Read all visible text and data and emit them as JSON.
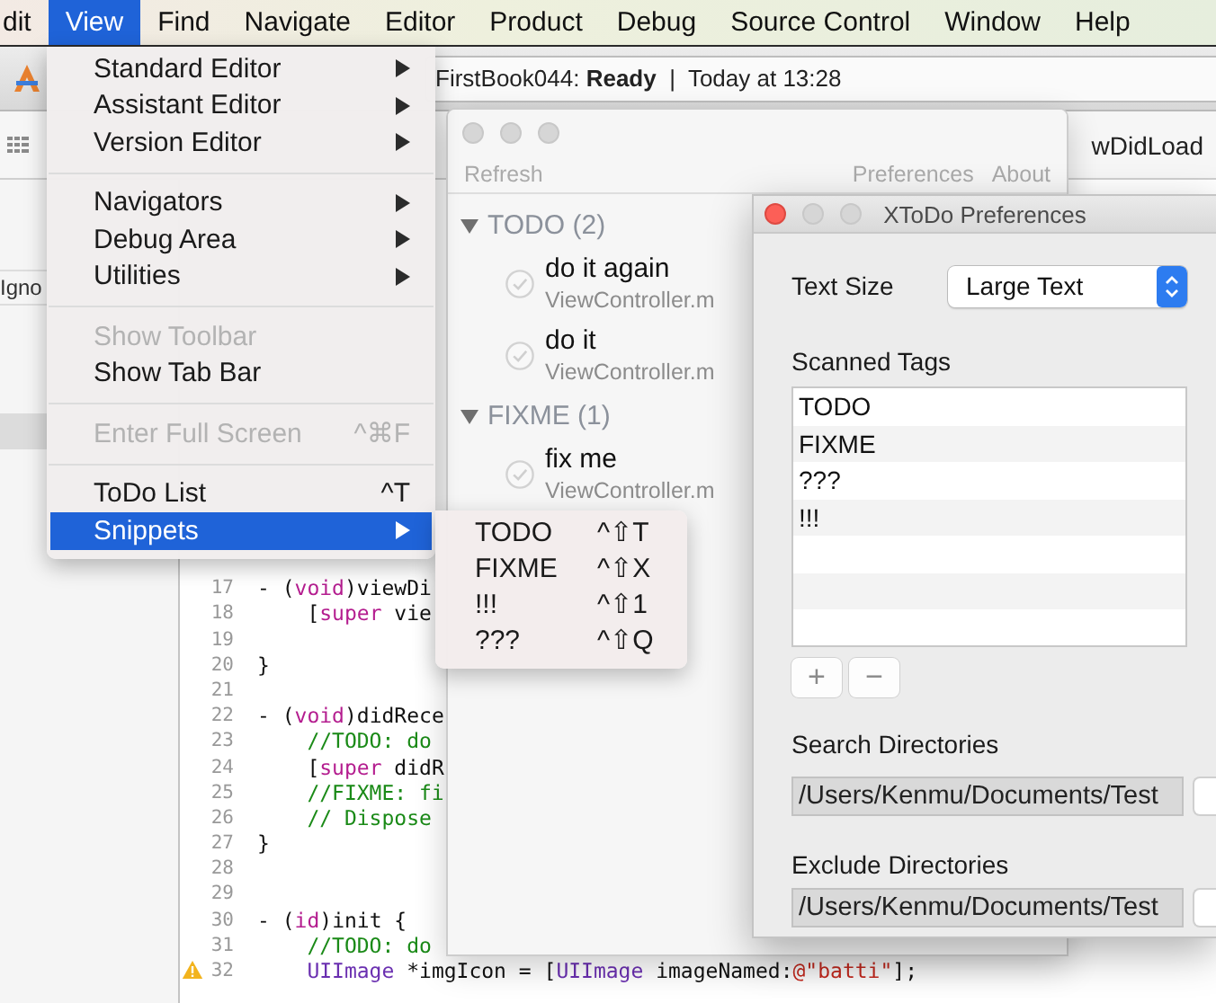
{
  "menu_bar": {
    "items": [
      {
        "label": "dit",
        "selected": false
      },
      {
        "label": "View",
        "selected": true
      },
      {
        "label": "Find",
        "selected": false
      },
      {
        "label": "Navigate",
        "selected": false
      },
      {
        "label": "Editor",
        "selected": false
      },
      {
        "label": "Product",
        "selected": false
      },
      {
        "label": "Debug",
        "selected": false
      },
      {
        "label": "Source Control",
        "selected": false
      },
      {
        "label": "Window",
        "selected": false
      },
      {
        "label": "Help",
        "selected": false
      }
    ]
  },
  "xcode": {
    "activity": "FirstBook044: **Ready**  |  Today at 13:28",
    "jump_bar_method": "wDidLoad",
    "navigator_fragment": "Igno",
    "code_lines": [
      {
        "number": "17",
        "warning": false,
        "tokens": [
          {
            "kind": "plain",
            "text": "- ("
          },
          {
            "kind": "keyword",
            "text": "void"
          },
          {
            "kind": "plain",
            "text": ")viewDi"
          }
        ]
      },
      {
        "number": "18",
        "warning": false,
        "tokens": [
          {
            "kind": "plain",
            "text": "    ["
          },
          {
            "kind": "keyword",
            "text": "super"
          },
          {
            "kind": "plain",
            "text": " vie"
          }
        ]
      },
      {
        "number": "19",
        "warning": false
      },
      {
        "number": "20",
        "warning": false,
        "tokens": [
          {
            "kind": "plain",
            "text": "}"
          }
        ]
      },
      {
        "number": "21",
        "warning": false
      },
      {
        "number": "22",
        "warning": false,
        "tokens": [
          {
            "kind": "plain",
            "text": "- ("
          },
          {
            "kind": "keyword",
            "text": "void"
          },
          {
            "kind": "plain",
            "text": ")didRece"
          }
        ]
      },
      {
        "number": "23",
        "warning": false,
        "tokens": [
          {
            "kind": "comment",
            "text": "    //TODO: do"
          }
        ]
      },
      {
        "number": "24",
        "warning": false,
        "tokens": [
          {
            "kind": "plain",
            "text": "    ["
          },
          {
            "kind": "keyword",
            "text": "super"
          },
          {
            "kind": "plain",
            "text": " didR"
          }
        ]
      },
      {
        "number": "25",
        "warning": false,
        "tokens": [
          {
            "kind": "comment",
            "text": "    //FIXME: fi"
          }
        ]
      },
      {
        "number": "26",
        "warning": false,
        "tokens": [
          {
            "kind": "comment",
            "text": "    // Dispose"
          }
        ]
      },
      {
        "number": "27",
        "warning": false,
        "tokens": [
          {
            "kind": "plain",
            "text": "}"
          }
        ]
      },
      {
        "number": "28",
        "warning": false
      },
      {
        "number": "29",
        "warning": false
      },
      {
        "number": "30",
        "warning": false,
        "tokens": [
          {
            "kind": "plain",
            "text": "- ("
          },
          {
            "kind": "keyword",
            "text": "id"
          },
          {
            "kind": "plain",
            "text": ")init {"
          }
        ]
      },
      {
        "number": "31",
        "warning": false,
        "tokens": [
          {
            "kind": "comment",
            "text": "    //TODO: do"
          }
        ]
      },
      {
        "number": "32",
        "warning": true,
        "tokens": [
          {
            "kind": "type",
            "text": "    UIImage"
          },
          {
            "kind": "plain",
            "text": " *imgIcon = ["
          },
          {
            "kind": "type",
            "text": "UIImage"
          },
          {
            "kind": "plain",
            "text": " imageNamed:"
          },
          {
            "kind": "string",
            "text": "@\"batti\""
          },
          {
            "kind": "plain",
            "text": "];"
          }
        ]
      }
    ]
  },
  "view_menu": {
    "items": [
      {
        "kind": "item",
        "label": "Standard Editor",
        "arrow": true,
        "disabled": false,
        "selected": false
      },
      {
        "kind": "item",
        "label": "Assistant Editor",
        "arrow": true,
        "disabled": false,
        "selected": false
      },
      {
        "kind": "item",
        "label": "Version Editor",
        "arrow": true,
        "disabled": false,
        "selected": false
      },
      {
        "kind": "separator"
      },
      {
        "kind": "item",
        "label": "Navigators",
        "arrow": true,
        "disabled": false,
        "selected": false
      },
      {
        "kind": "item",
        "label": "Debug Area",
        "arrow": true,
        "disabled": false,
        "selected": false
      },
      {
        "kind": "item",
        "label": "Utilities",
        "arrow": true,
        "disabled": false,
        "selected": false
      },
      {
        "kind": "separator"
      },
      {
        "kind": "item",
        "label": "Show Toolbar",
        "arrow": false,
        "disabled": true,
        "selected": false
      },
      {
        "kind": "item",
        "label": "Show Tab Bar",
        "arrow": false,
        "disabled": false,
        "selected": false
      },
      {
        "kind": "separator"
      },
      {
        "kind": "item",
        "label": "Enter Full Screen",
        "shortcut": "^⌘F",
        "arrow": false,
        "disabled": true,
        "selected": false
      },
      {
        "kind": "separator"
      },
      {
        "kind": "item",
        "label": "ToDo List",
        "shortcut": "^T",
        "arrow": false,
        "disabled": false,
        "selected": false
      },
      {
        "kind": "item",
        "label": "Snippets",
        "arrow": true,
        "disabled": false,
        "selected": true,
        "submenu": [
          {
            "label": "TODO",
            "shortcut": "^⇧T"
          },
          {
            "label": "FIXME",
            "shortcut": "^⇧X"
          },
          {
            "label": "!!!",
            "shortcut": "^⇧1"
          },
          {
            "label": "???",
            "shortcut": "^⇧Q"
          }
        ]
      }
    ]
  },
  "todo_window": {
    "active": false,
    "toolbar": {
      "left": [
        "Refresh"
      ],
      "right": [
        "Preferences",
        "About"
      ]
    },
    "groups": [
      {
        "label": "TODO (2)",
        "expanded": true,
        "children": [
          {
            "title": "do it again",
            "file": "ViewController.m"
          },
          {
            "title": "do it",
            "file": "ViewController.m"
          }
        ]
      },
      {
        "label": "FIXME (1)",
        "expanded": true,
        "children": [
          {
            "title": "fix me",
            "file": "ViewController.m"
          }
        ]
      }
    ]
  },
  "preferences_window": {
    "active": true,
    "title": "XToDo Preferences",
    "text_size": {
      "label": "Text Size",
      "value": "Large Text"
    },
    "scanned_tags": {
      "label": "Scanned Tags",
      "tags": [
        "TODO",
        "FIXME",
        "???",
        "!!!"
      ],
      "add_button": "+",
      "remove_button": "−"
    },
    "search_directories": {
      "label": "Search Directories",
      "value": "/Users/Kenmu/Documents/Test"
    },
    "exclude_directories": {
      "label": "Exclude Directories",
      "value": "/Users/Kenmu/Documents/Test"
    }
  }
}
